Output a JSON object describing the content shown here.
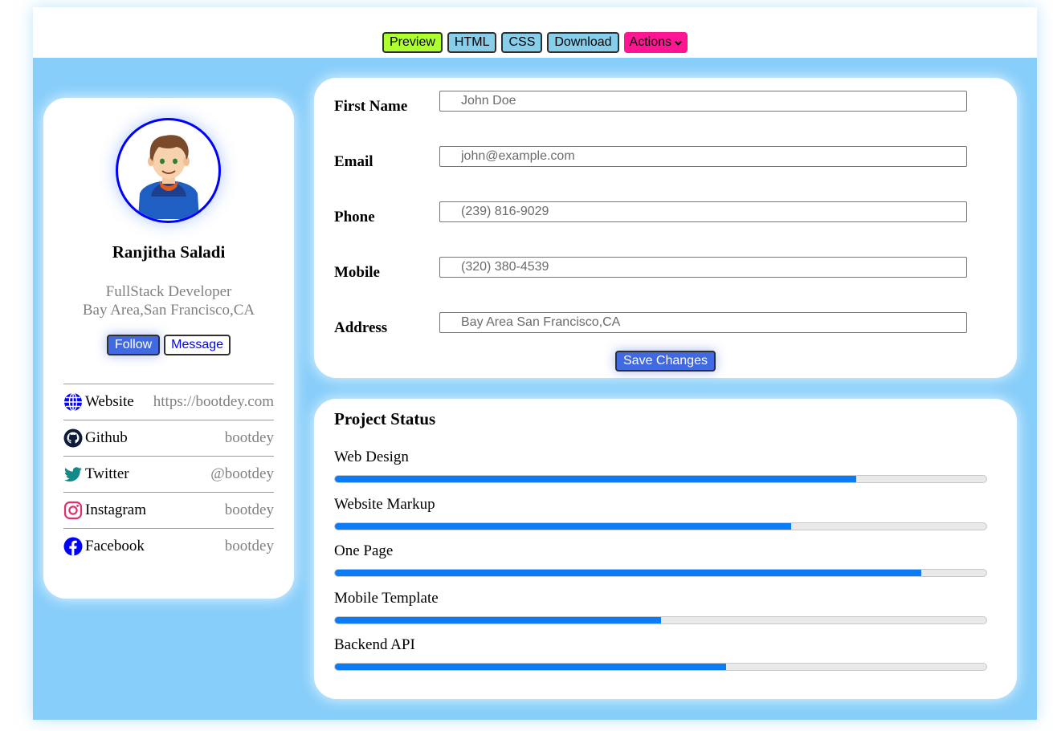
{
  "toolbar": {
    "preview": "Preview",
    "html": "HTML",
    "css": "CSS",
    "download": "Download",
    "actions": "Actions"
  },
  "profile": {
    "name": "Ranjitha Saladi",
    "role": "FullStack Developer",
    "location": "Bay Area,San Francisco,CA",
    "follow": "Follow",
    "message": "Message",
    "socials": [
      {
        "label": "Website",
        "value": "https://bootdey.com",
        "icon": "globe-icon"
      },
      {
        "label": "Github",
        "value": "bootdey",
        "icon": "github-icon"
      },
      {
        "label": "Twitter",
        "value": "@bootdey",
        "icon": "twitter-icon"
      },
      {
        "label": "Instagram",
        "value": "bootdey",
        "icon": "instagram-icon"
      },
      {
        "label": "Facebook",
        "value": "bootdey",
        "icon": "facebook-icon"
      }
    ]
  },
  "form": {
    "fields": [
      {
        "label": "First Name",
        "value": "John Doe"
      },
      {
        "label": "Email",
        "value": "john@example.com"
      },
      {
        "label": "Phone",
        "value": "(239) 816-9029"
      },
      {
        "label": "Mobile",
        "value": "(320) 380-4539"
      },
      {
        "label": "Address",
        "value": "Bay Area San Francisco,CA"
      }
    ],
    "save": "Save Changes"
  },
  "status": {
    "title": "Project Status",
    "projects": [
      {
        "label": "Web Design",
        "progress": 80
      },
      {
        "label": "Website Markup",
        "progress": 70
      },
      {
        "label": "One Page",
        "progress": 90
      },
      {
        "label": "Mobile Template",
        "progress": 50
      },
      {
        "label": "Backend API",
        "progress": 60
      }
    ]
  },
  "colors": {
    "page_bg": "#87cefa",
    "preview": "#adff2f",
    "code_buttons": "#87ceeb",
    "actions": "#ff1493",
    "primary": "#4169e1",
    "progress": "#0a7cf6",
    "avatar_ring": "#0000ff"
  }
}
